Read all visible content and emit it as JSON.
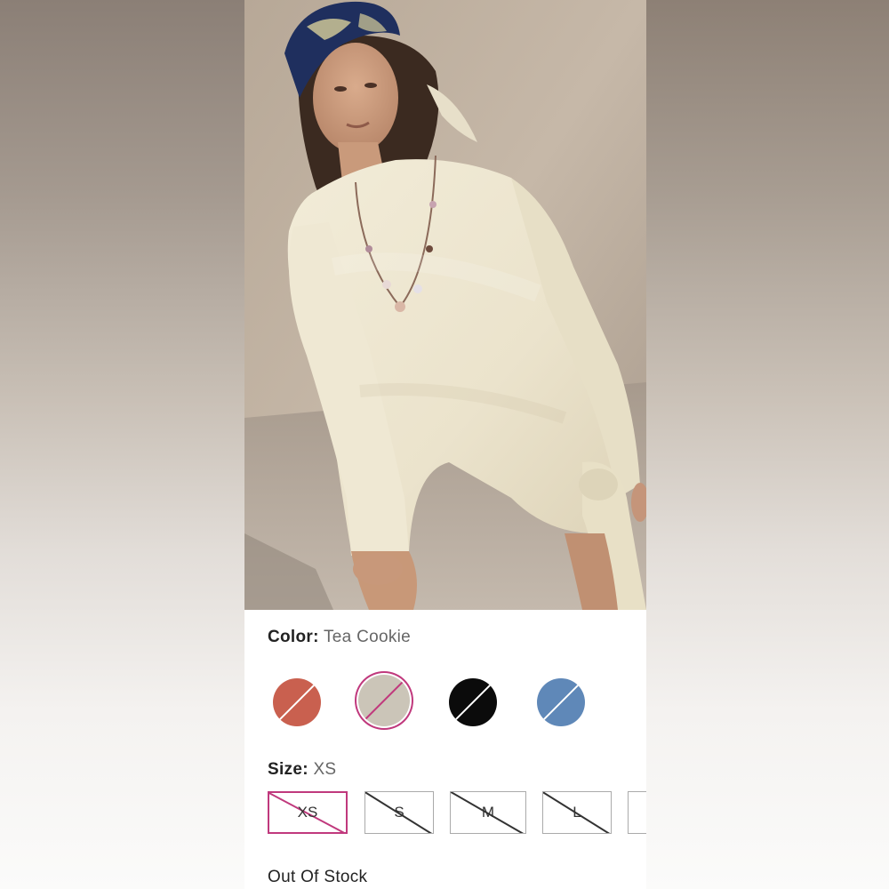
{
  "product": {
    "image_alt": "Model wearing cream knit long-sleeve dress with headscarf and beaded necklace"
  },
  "color": {
    "label": "Color:",
    "selected": "Tea Cookie",
    "swatches": [
      {
        "name": "terracotta",
        "hex": "#c9604f",
        "available": false
      },
      {
        "name": "tea-cookie",
        "hex": "#cbc5b8",
        "available": false,
        "selected": true
      },
      {
        "name": "black",
        "hex": "#0b0b0b",
        "available": false
      },
      {
        "name": "blue",
        "hex": "#5f88b8",
        "available": false
      }
    ]
  },
  "size": {
    "label": "Size:",
    "selected": "XS",
    "options": [
      "XS",
      "S",
      "M",
      "L",
      ""
    ]
  },
  "stock_status": "Out Of Stock",
  "colors": {
    "accent": "#c0397d",
    "text": "#222222"
  }
}
